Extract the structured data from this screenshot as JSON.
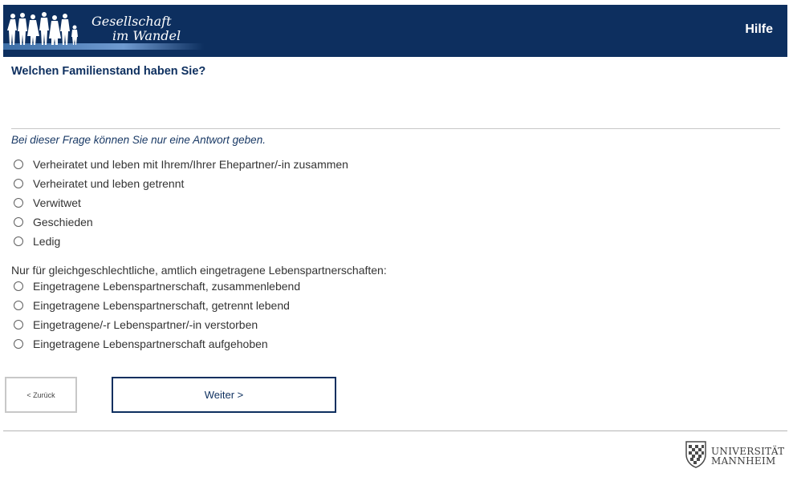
{
  "header": {
    "logo_line1": "Gesellschaft",
    "logo_line2": "im Wandel",
    "help_label": "Hilfe"
  },
  "question": {
    "title": "Welchen Familienstand haben Sie?",
    "instruction": "Bei dieser Frage können Sie nur eine Antwort geben."
  },
  "options": [
    {
      "label": "Verheiratet und leben mit Ihrem/Ihrer Ehepartner/-in zusammen"
    },
    {
      "label": "Verheiratet und leben getrennt"
    },
    {
      "label": "Verwitwet"
    },
    {
      "label": "Geschieden"
    },
    {
      "label": "Ledig"
    }
  ],
  "partnership_group": {
    "heading": "Nur für gleichgeschlechtliche, amtlich eingetragene Lebenspartnerschaften:",
    "options": [
      {
        "label": "Eingetragene Lebenspartnerschaft, zusammenlebend"
      },
      {
        "label": "Eingetragene Lebenspartnerschaft, getrennt lebend"
      },
      {
        "label": "Eingetragene/-r Lebenspartner/-in verstorben"
      },
      {
        "label": "Eingetragene Lebenspartnerschaft aufgehoben"
      }
    ]
  },
  "navigation": {
    "back_label": "< Zurück",
    "next_label": "Weiter >"
  },
  "footer": {
    "university_line1": "UNIVERSITÄT",
    "university_line2": "MANNHEIM"
  },
  "colors": {
    "brand": "#0d2f5f",
    "text": "#333333"
  }
}
